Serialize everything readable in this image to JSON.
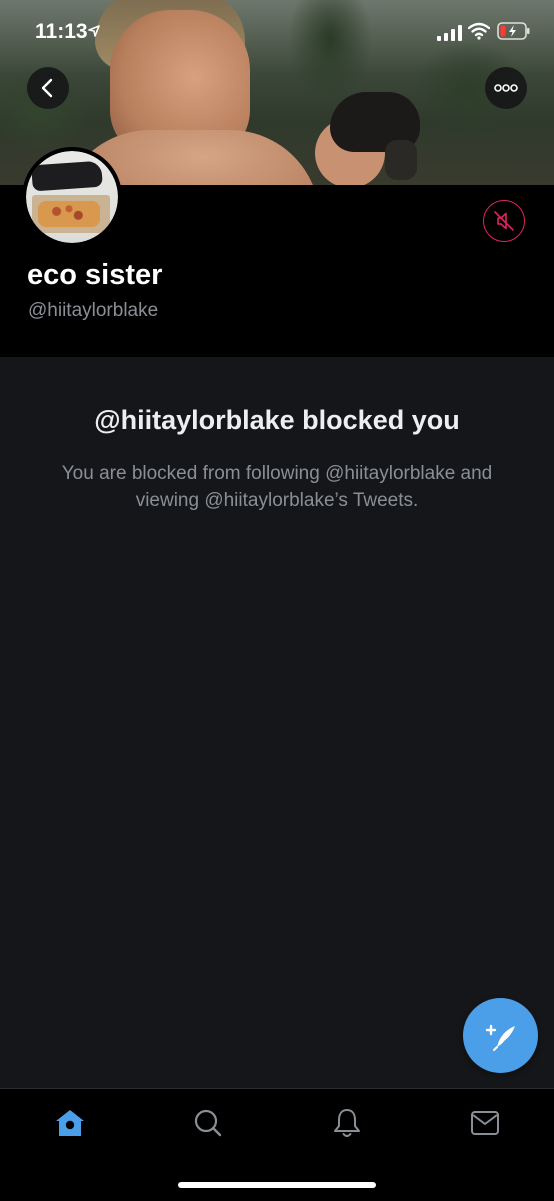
{
  "status_bar": {
    "time": "11:13"
  },
  "profile": {
    "display_name": "eco sister",
    "handle": "@hiitaylorblake"
  },
  "blocked": {
    "title": "@hiitaylorblake blocked you",
    "description": "You are blocked from following @hiitaylorblake and viewing @hiitaylorblake’s Tweets."
  },
  "icons": {
    "back": "chevron-left-icon",
    "more": "more-dots-icon",
    "mute": "muted-speaker-icon",
    "compose": "compose-feather-icon",
    "tabs": [
      "home-icon",
      "search-icon",
      "bell-icon",
      "mail-icon"
    ]
  },
  "colors": {
    "accent": "#4b9ee8",
    "mute_red": "#e0245e",
    "background": "#151619",
    "header_black": "#000000",
    "secondary_text": "#8a8f96"
  }
}
